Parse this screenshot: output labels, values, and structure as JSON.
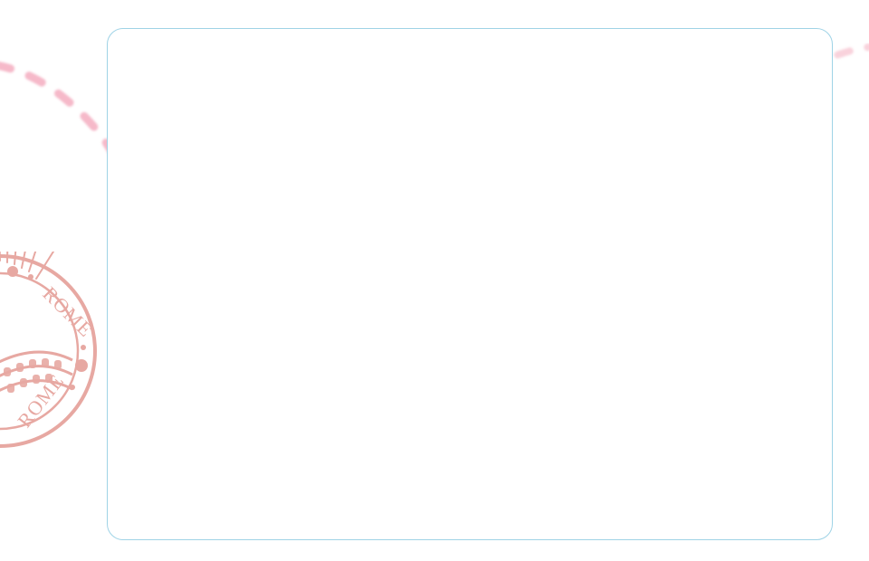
{
  "stamp": {
    "text_top": "ROME",
    "text_bottom": "ROME",
    "icon": "rome-colosseum-stamp-icon",
    "color": "#e39a92"
  },
  "decoration": {
    "dashed_trail_color": "#ee7f9c",
    "icon": "dashed-flight-path-icon"
  },
  "card": {
    "border_color": "#9fd3e6",
    "background": "#ffffff"
  }
}
